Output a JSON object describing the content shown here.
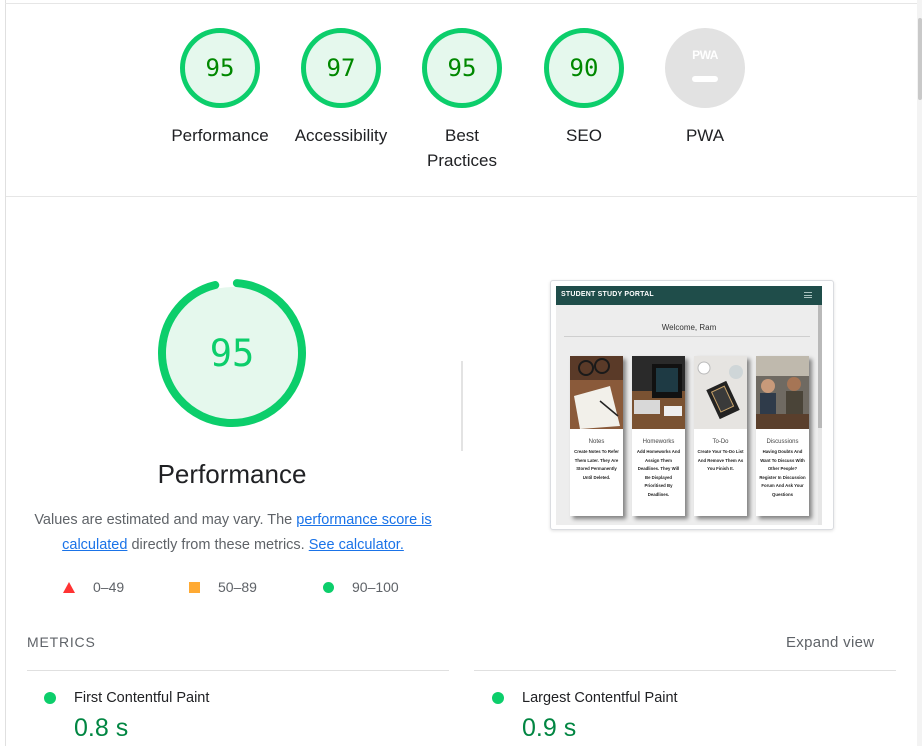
{
  "categories": [
    {
      "name": "Performance",
      "score": "95"
    },
    {
      "name": "Accessibility",
      "score": "97"
    },
    {
      "name": "Best Practices",
      "score": "95"
    },
    {
      "name": "SEO",
      "score": "90"
    },
    {
      "name": "PWA",
      "score": "",
      "badge_text": "PWA"
    }
  ],
  "performance": {
    "score": "95",
    "score_fraction": 0.95,
    "title": "Performance",
    "desc_prefix": "Values are estimated and may vary. The ",
    "desc_link1": "performance score is calculated",
    "desc_middle": " directly from these metrics. ",
    "desc_link2": "See calculator."
  },
  "legend": {
    "fail": "0–49",
    "average": "50–89",
    "pass": "90–100"
  },
  "colors": {
    "pass": "#0cce6b",
    "pass_text": "#008800",
    "average": "#ffaa33",
    "fail": "#ff3333",
    "link": "#1a73e8"
  },
  "screenshot": {
    "brand": "STUDENT STUDY PORTAL",
    "welcome": "Welcome, Ram",
    "cards": [
      {
        "title": "Notes",
        "text": "Create Notes To Refer Them Later. They Are Stored Permanently Until Deleted."
      },
      {
        "title": "Homeworks",
        "text": "Add Homeworks And Assign Them Deadlines. They Will Be Displayed Prioritised By Deadlines."
      },
      {
        "title": "To-Do",
        "text": "Create Your To-Do List And Remove Them As You Finish It."
      },
      {
        "title": "Discussions",
        "text": "Having Doubts And Want To Discuss With Other People? Register In Discussion Forum And Ask Your Questions"
      }
    ]
  },
  "metrics": {
    "label": "METRICS",
    "expand": "Expand view",
    "items": [
      {
        "name": "First Contentful Paint",
        "value": "0.8 s"
      },
      {
        "name": "Largest Contentful Paint",
        "value": "0.9 s"
      }
    ]
  }
}
